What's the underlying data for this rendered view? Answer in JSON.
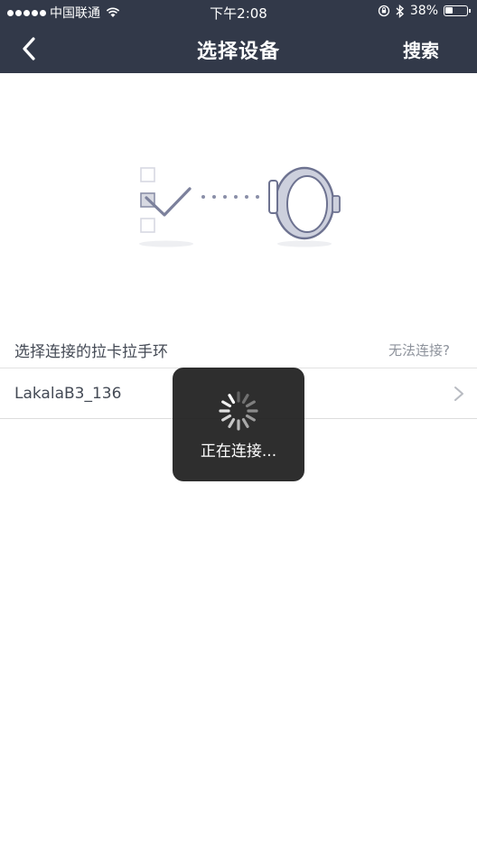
{
  "status_bar": {
    "carrier": "中国联通",
    "time": "下午2:08",
    "battery_percent": "38%",
    "battery_level": 0.38,
    "icons": [
      "signal-dots",
      "wifi-icon",
      "orientation-lock-icon",
      "bluetooth-icon",
      "battery-icon"
    ]
  },
  "nav": {
    "title": "选择设备",
    "action_label": "搜索",
    "back_icon": "chevron-left-icon"
  },
  "illustration": {
    "icons": [
      "checklist-icon",
      "check-mark-icon",
      "dotted-connector-icon",
      "wristband-icon"
    ]
  },
  "section": {
    "title": "选择连接的拉卡拉手环",
    "help_link": "无法连接?"
  },
  "devices": [
    {
      "name": "LakalaB3_136",
      "icon": "chevron-right-icon"
    }
  ],
  "toast": {
    "message": "正在连接...",
    "icon": "spinner-icon"
  },
  "colors": {
    "header_bg": "#323949",
    "illustration": "#8a8fa8",
    "toast_bg": "#1e1e1e",
    "text_primary": "#444a55",
    "text_secondary": "#8e939c"
  }
}
